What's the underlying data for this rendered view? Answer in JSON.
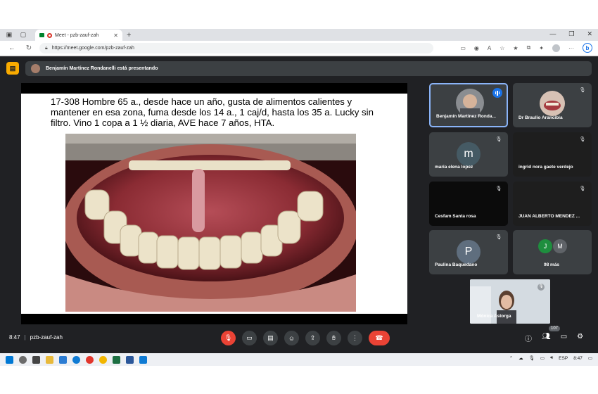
{
  "browser": {
    "tab_title": "Meet - pzb-zauf-zah",
    "url": "https://meet.google.com/pzb-zauf-zah"
  },
  "meet": {
    "presenting_banner": "Benjamín Martínez Rondanelli está presentando",
    "slide_text": "17-308 Hombre 65 a., desde hace un año, gusta de alimentos calientes y mantener en esa zona, fuma desde los 14 a., 1 caj/d, hasta los 35 a. Lucky sin filtro. Vino 1 copa a 1 ½ diaria, AVE hace 7 años, HTA.",
    "participants": [
      {
        "name": "Benjamín Martínez Ronda...",
        "initial": "",
        "color": ""
      },
      {
        "name": "Dr Braulio Arancibia",
        "initial": "",
        "color": ""
      },
      {
        "name": "maria elena lopez",
        "initial": "m",
        "color": "#455a64"
      },
      {
        "name": "ingrid nora gaete verdejo",
        "initial": "",
        "color": ""
      },
      {
        "name": "Cesfam Santa rosa",
        "initial": "",
        "color": ""
      },
      {
        "name": "JUAN ALBERTO MENDEZ ...",
        "initial": "",
        "color": ""
      },
      {
        "name": "Paulina Baquedano",
        "initial": "P",
        "color": "#5f6e7e"
      },
      {
        "name": "98 más",
        "initial": "",
        "color": ""
      }
    ],
    "more_avatars": [
      "J",
      "M"
    ],
    "self_name": "Mónica Astorga",
    "meeting_time": "8:47",
    "meeting_code": "pzb-zauf-zah",
    "participant_count": "107"
  },
  "taskbar": {
    "lang": "ESP",
    "time": "8:47"
  },
  "colors": {
    "meet_bg": "#202124",
    "tile_bg": "#3c4043",
    "end_call": "#ea4335",
    "present_icon": "#f9ab00"
  }
}
